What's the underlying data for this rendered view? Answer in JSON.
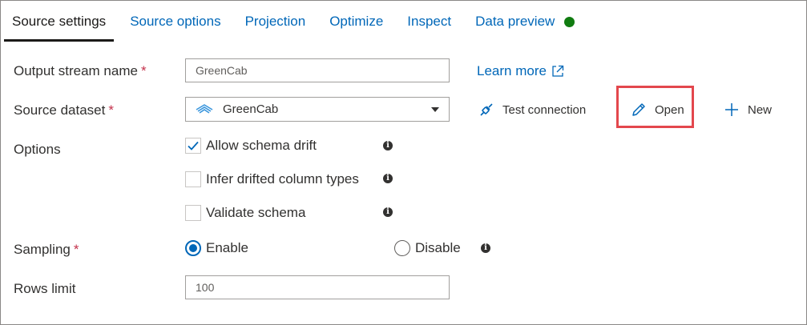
{
  "tabs": [
    {
      "label": "Source settings",
      "active": true
    },
    {
      "label": "Source options"
    },
    {
      "label": "Projection"
    },
    {
      "label": "Optimize"
    },
    {
      "label": "Inspect"
    },
    {
      "label": "Data preview",
      "status_dot_color": "#107c10"
    }
  ],
  "fields": {
    "output_stream": {
      "label": "Output stream name",
      "required_mark": "*",
      "value": "GreenCab"
    },
    "source_dataset": {
      "label": "Source dataset",
      "required_mark": "*",
      "value": "GreenCab",
      "icon": "dataset-icon"
    },
    "options": {
      "label": "Options"
    },
    "sampling": {
      "label": "Sampling",
      "required_mark": "*"
    },
    "rows_limit": {
      "label": "Rows limit",
      "value": "100"
    }
  },
  "links": {
    "learn_more": "Learn more"
  },
  "actions": {
    "test_connection": "Test connection",
    "open": "Open",
    "new": "New"
  },
  "checkboxes": [
    {
      "label": "Allow schema drift",
      "checked": true
    },
    {
      "label": "Infer drifted column types",
      "checked": false
    },
    {
      "label": "Validate schema",
      "checked": false
    }
  ],
  "radios": [
    {
      "label": "Enable",
      "selected": true
    },
    {
      "label": "Disable",
      "selected": false
    }
  ],
  "info_glyph": "i",
  "colors": {
    "accent": "#0067b8",
    "required": "#c4314b",
    "highlight": "#e3474d",
    "status_ok": "#107c10"
  }
}
